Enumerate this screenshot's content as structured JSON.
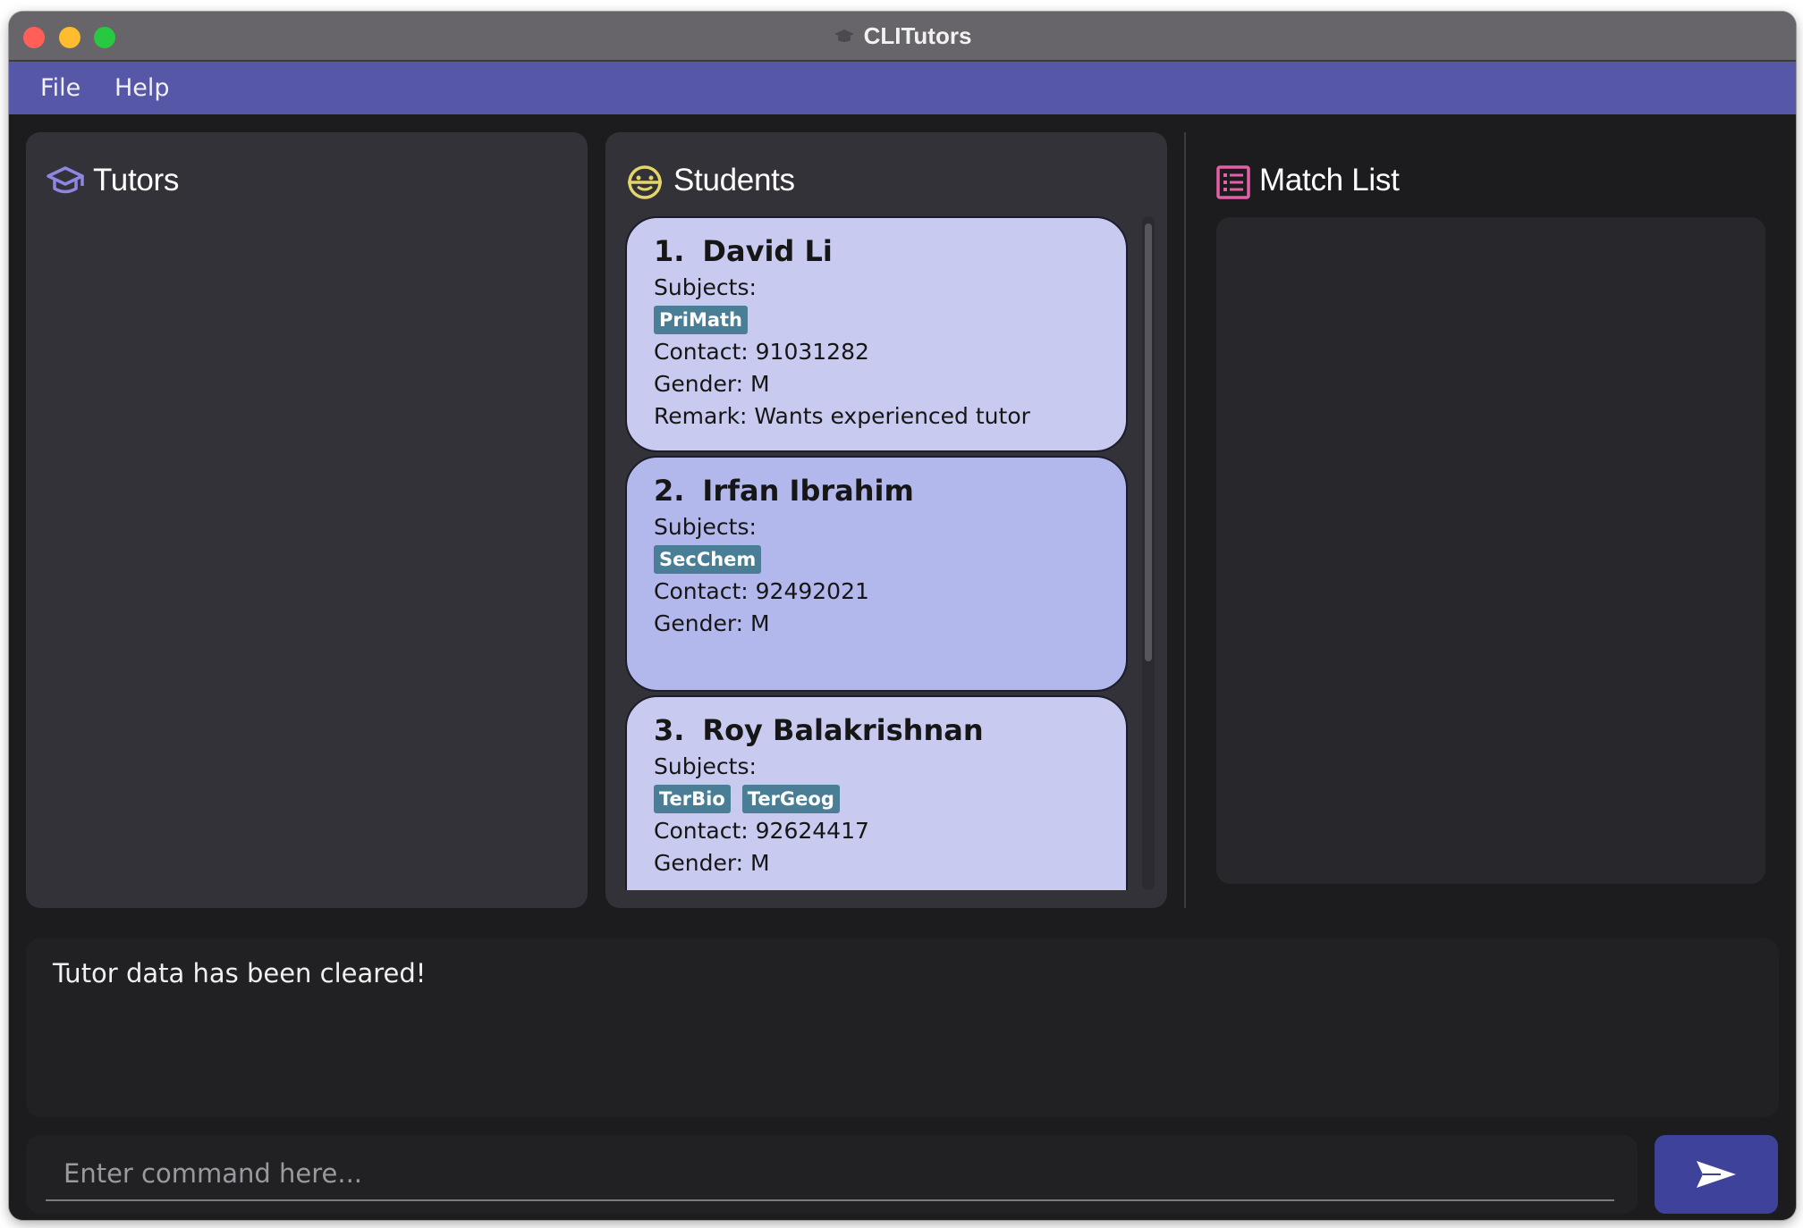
{
  "window": {
    "title": "CLITutors"
  },
  "menu": {
    "items": [
      {
        "label": "File"
      },
      {
        "label": "Help"
      }
    ]
  },
  "panels": {
    "tutors": {
      "title": "Tutors",
      "icon": "graduation-cap-icon"
    },
    "students": {
      "title": "Students",
      "icon": "smiley-face-icon"
    },
    "match": {
      "title": "Match List",
      "icon": "list-icon"
    }
  },
  "students": [
    {
      "index": "1.",
      "name": "David Li",
      "subjects_label": "Subjects:",
      "subjects": [
        "PriMath"
      ],
      "contact": "Contact: 91031282",
      "gender": "Gender: M",
      "remark": "Remark: Wants experienced tutor"
    },
    {
      "index": "2.",
      "name": "Irfan Ibrahim",
      "subjects_label": "Subjects:",
      "subjects": [
        "SecChem"
      ],
      "contact": "Contact: 92492021",
      "gender": "Gender: M",
      "remark": ""
    },
    {
      "index": "3.",
      "name": "Roy Balakrishnan",
      "subjects_label": "Subjects:",
      "subjects": [
        "TerBio",
        "TerGeog"
      ],
      "contact": "Contact: 92624417",
      "gender": "Gender: M",
      "remark": ""
    }
  ],
  "result": {
    "message": "Tutor data has been cleared!"
  },
  "command": {
    "placeholder": "Enter command here...",
    "value": "",
    "send_icon": "send-icon"
  },
  "colors": {
    "accent": "#5657a6",
    "card": "#c9caf0",
    "card_selected": "#b3b8ec",
    "tag": "#4a7e96",
    "send_button": "#3f429a"
  }
}
